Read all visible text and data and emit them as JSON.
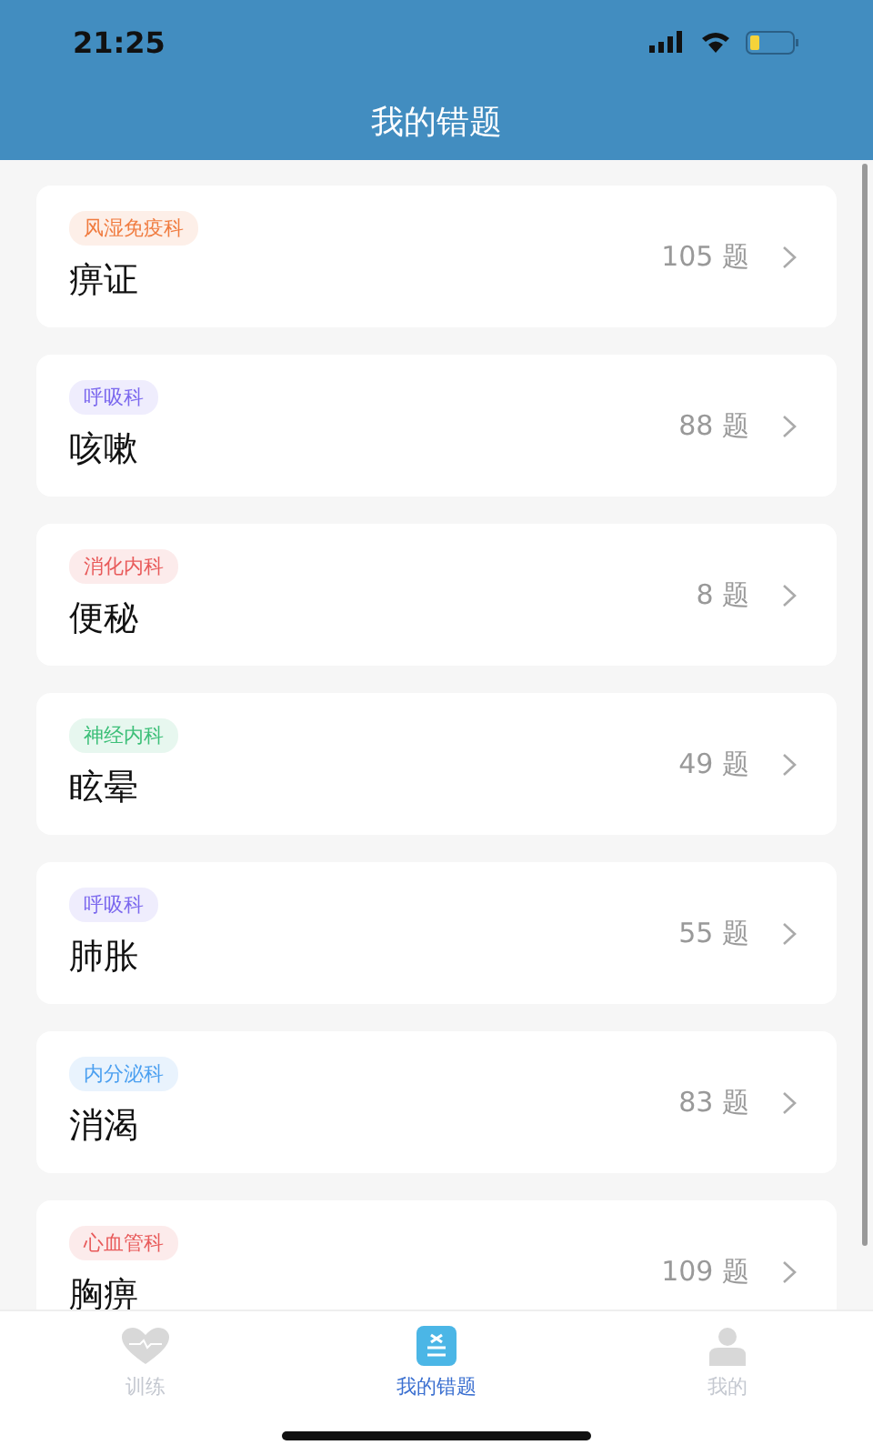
{
  "status_bar": {
    "time": "21:25"
  },
  "header": {
    "title": "我的错题"
  },
  "items": [
    {
      "tag": "风湿免疫科",
      "color": "#f07b3f",
      "title": "痹证",
      "count": "105 题"
    },
    {
      "tag": "呼吸科",
      "color": "#7b68ee",
      "title": "咳嗽",
      "count": "88 题"
    },
    {
      "tag": "消化内科",
      "color": "#e85a5a",
      "title": "便秘",
      "count": "8 题"
    },
    {
      "tag": "神经内科",
      "color": "#3cbf78",
      "title": "眩晕",
      "count": "49 题"
    },
    {
      "tag": "呼吸科",
      "color": "#7b68ee",
      "title": "肺胀",
      "count": "55 题"
    },
    {
      "tag": "内分泌科",
      "color": "#4a9ff0",
      "title": "消渴",
      "count": "83 题"
    },
    {
      "tag": "心血管科",
      "color": "#e85a5a",
      "title": "胸痹",
      "count": "109 题"
    }
  ],
  "tabs": [
    {
      "kind": "training",
      "label": "训练",
      "selected": false
    },
    {
      "kind": "mistakes",
      "label": "我的错题",
      "selected": true
    },
    {
      "kind": "profile",
      "label": "我的",
      "selected": false
    }
  ]
}
